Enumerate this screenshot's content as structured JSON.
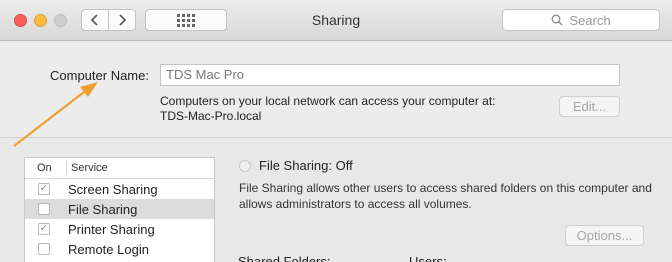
{
  "window": {
    "title": "Sharing"
  },
  "toolbar": {
    "search_placeholder": "Search"
  },
  "computer_name": {
    "label": "Computer Name:",
    "value": "TDS Mac Pro",
    "info_line1": "Computers on your local network can access your computer at:",
    "info_line2": "TDS-Mac-Pro.local",
    "edit_button": "Edit..."
  },
  "services": {
    "header_on": "On",
    "header_service": "Service",
    "items": [
      {
        "label": "Screen Sharing",
        "checked": true,
        "selected": false
      },
      {
        "label": "File Sharing",
        "checked": false,
        "selected": true
      },
      {
        "label": "Printer Sharing",
        "checked": true,
        "selected": false
      },
      {
        "label": "Remote Login",
        "checked": false,
        "selected": false
      }
    ]
  },
  "detail": {
    "status": "File Sharing: Off",
    "description": "File Sharing allows other users to access shared folders on this computer and allows administrators to access all volumes.",
    "options_button": "Options...",
    "shared_folders_label": "Shared Folders:",
    "users_label": "Users:"
  },
  "annotation": {
    "arrow_color": "#f0a030"
  }
}
